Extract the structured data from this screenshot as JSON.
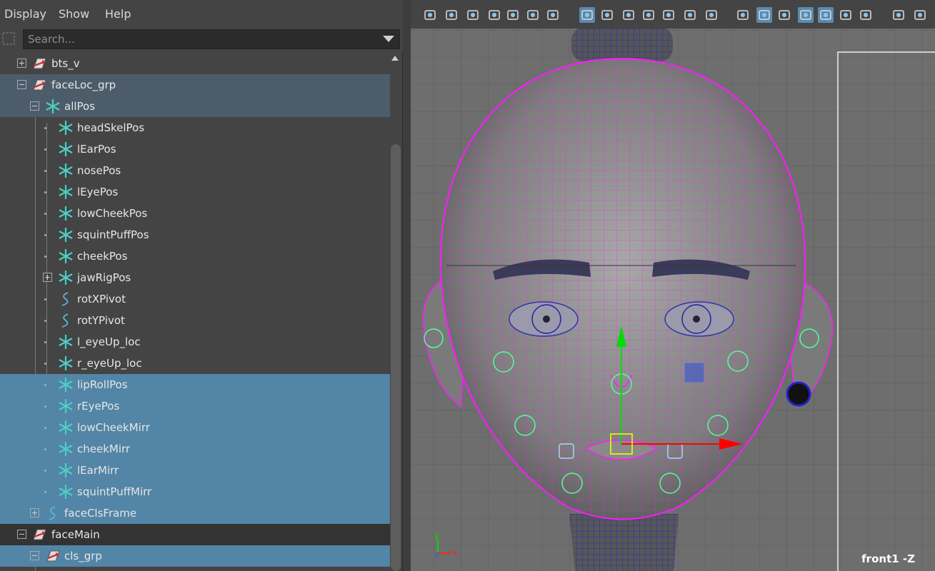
{
  "menu": {
    "display": "Display",
    "show": "Show",
    "help": "Help"
  },
  "search": {
    "placeholder": "Search..."
  },
  "outliner": {
    "items": [
      {
        "label": "bts_v",
        "icon": "group-icon",
        "state": "none"
      },
      {
        "label": "faceLoc_grp",
        "icon": "group-icon",
        "state": "dark"
      },
      {
        "label": "allPos",
        "icon": "locator-icon",
        "state": "dark"
      },
      {
        "label": "headSkelPos",
        "icon": "locator-icon",
        "state": "none"
      },
      {
        "label": "lEarPos",
        "icon": "locator-icon",
        "state": "none"
      },
      {
        "label": "nosePos",
        "icon": "locator-icon",
        "state": "none"
      },
      {
        "label": "lEyePos",
        "icon": "locator-icon",
        "state": "none"
      },
      {
        "label": "lowCheekPos",
        "icon": "locator-icon",
        "state": "none"
      },
      {
        "label": "squintPuffPos",
        "icon": "locator-icon",
        "state": "none"
      },
      {
        "label": "cheekPos",
        "icon": "locator-icon",
        "state": "none"
      },
      {
        "label": "jawRigPos",
        "icon": "locator-icon",
        "state": "none"
      },
      {
        "label": "rotXPivot",
        "icon": "curve-icon",
        "state": "none"
      },
      {
        "label": "rotYPivot",
        "icon": "curve-icon",
        "state": "none"
      },
      {
        "label": "l_eyeUp_loc",
        "icon": "locator-icon",
        "state": "none"
      },
      {
        "label": "r_eyeUp_loc",
        "icon": "locator-icon",
        "state": "none"
      },
      {
        "label": "lipRollPos",
        "icon": "locator-icon",
        "state": "light"
      },
      {
        "label": "rEyePos",
        "icon": "locator-icon",
        "state": "light"
      },
      {
        "label": "lowCheekMirr",
        "icon": "locator-icon",
        "state": "light"
      },
      {
        "label": "cheekMirr",
        "icon": "locator-icon",
        "state": "light"
      },
      {
        "label": "lEarMirr",
        "icon": "locator-icon",
        "state": "light"
      },
      {
        "label": "squintPuffMirr",
        "icon": "locator-icon",
        "state": "light"
      },
      {
        "label": "faceClsFrame",
        "icon": "curve-icon",
        "state": "light"
      },
      {
        "label": "faceMain",
        "icon": "group-icon",
        "state": "mid"
      },
      {
        "label": "cls_grp",
        "icon": "group-icon",
        "state": "light"
      }
    ]
  },
  "viewport": {
    "camera_label": "front1 -Z",
    "axis_y": "y",
    "axis_z": "z",
    "axis_x": "x"
  },
  "colors": {
    "selection_dark": "#4d5c6b",
    "selection_light": "#5285a6",
    "wireframe": "#ff00ff",
    "locator": "#4ecdc4"
  }
}
